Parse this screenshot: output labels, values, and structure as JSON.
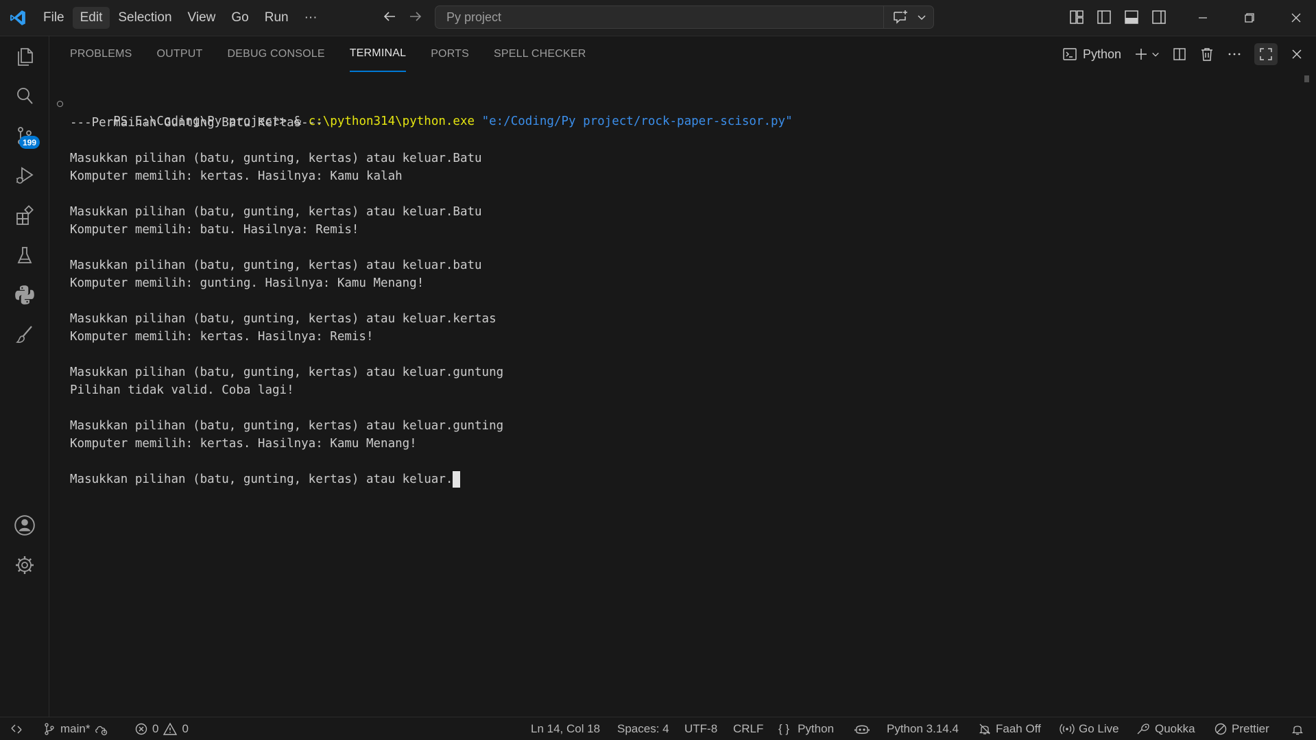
{
  "titlebar": {
    "menu": [
      "File",
      "Edit",
      "Selection",
      "View",
      "Go",
      "Run"
    ],
    "active_menu": "Edit",
    "more": "···",
    "search_text": "Py project"
  },
  "activitybar": {
    "items": [
      "explorer-icon",
      "search-icon",
      "source-control-icon",
      "run-debug-icon",
      "extensions-icon",
      "testing-icon",
      "python-icon",
      "brush-icon"
    ],
    "scm_badge": "199",
    "bottom": [
      "accounts-icon",
      "settings-gear-icon"
    ]
  },
  "panel": {
    "tabs": [
      "PROBLEMS",
      "OUTPUT",
      "DEBUG CONSOLE",
      "TERMINAL",
      "PORTS",
      "SPELL CHECKER"
    ],
    "active_tab": "TERMINAL",
    "terminal_profile": "Python"
  },
  "terminal": {
    "prompt": "PS E:\\Coding\\Py project> ",
    "command_amp": "& ",
    "command_exe": "c:\\python314\\python.exe",
    "command_arg": " \"e:/Coding/Py project/rock-paper-scisor.py\"",
    "lines": [
      "---Permainan Gunting Batu Kertas---",
      "",
      "Masukkan pilihan (batu, gunting, kertas) atau keluar.Batu",
      "Komputer memilih: kertas. Hasilnya: Kamu kalah",
      "",
      "Masukkan pilihan (batu, gunting, kertas) atau keluar.Batu",
      "Komputer memilih: batu. Hasilnya: Remis!",
      "",
      "Masukkan pilihan (batu, gunting, kertas) atau keluar.batu",
      "Komputer memilih: gunting. Hasilnya: Kamu Menang!",
      "",
      "Masukkan pilihan (batu, gunting, kertas) atau keluar.kertas",
      "Komputer memilih: kertas. Hasilnya: Remis!",
      "",
      "Masukkan pilihan (batu, gunting, kertas) atau keluar.guntung",
      "Pilihan tidak valid. Coba lagi!",
      "",
      "Masukkan pilihan (batu, gunting, kertas) atau keluar.gunting",
      "Komputer memilih: kertas. Hasilnya: Kamu Menang!",
      "",
      "Masukkan pilihan (batu, gunting, kertas) atau keluar."
    ]
  },
  "statusbar": {
    "branch": "main*",
    "errors": "0",
    "warnings": "0",
    "cursor_pos": "Ln 14, Col 18",
    "spaces": "Spaces: 4",
    "encoding": "UTF-8",
    "eol": "CRLF",
    "language_braces": "{ }",
    "language": "Python",
    "interpreter": "Python 3.14.4",
    "faah": "Faah Off",
    "go_live": "Go Live",
    "quokka": "Quokka",
    "prettier": "Prettier"
  },
  "colors": {
    "accent": "#0078d4",
    "terminal_yellow": "#e5e510",
    "terminal_blue": "#3b8eea",
    "background": "#181818"
  }
}
